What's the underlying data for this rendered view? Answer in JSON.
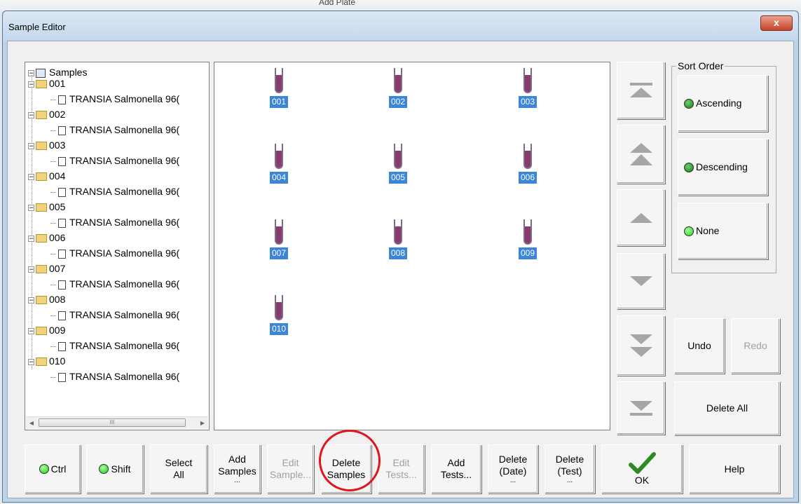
{
  "background_window": {
    "label": "Add Plate"
  },
  "window": {
    "title": "Sample Editor",
    "close_label": "x"
  },
  "tree": {
    "root": "Samples",
    "items": [
      {
        "id": "001",
        "child": "TRANSIA Salmonella 96("
      },
      {
        "id": "002",
        "child": "TRANSIA Salmonella 96("
      },
      {
        "id": "003",
        "child": "TRANSIA Salmonella 96("
      },
      {
        "id": "004",
        "child": "TRANSIA Salmonella 96("
      },
      {
        "id": "005",
        "child": "TRANSIA Salmonella 96("
      },
      {
        "id": "006",
        "child": "TRANSIA Salmonella 96("
      },
      {
        "id": "007",
        "child": "TRANSIA Salmonella 96("
      },
      {
        "id": "008",
        "child": "TRANSIA Salmonella 96("
      },
      {
        "id": "009",
        "child": "TRANSIA Salmonella 96("
      },
      {
        "id": "010",
        "child": "TRANSIA Salmonella 96("
      }
    ],
    "scroll_grip": "III"
  },
  "tubes": [
    "001",
    "002",
    "003",
    "004",
    "005",
    "006",
    "007",
    "008",
    "009",
    "010"
  ],
  "sort_order": {
    "legend": "Sort Order",
    "options": [
      {
        "label": "Ascending",
        "state": "dark"
      },
      {
        "label": "Descending",
        "state": "dark"
      },
      {
        "label": "None",
        "state": "bright"
      }
    ]
  },
  "side_buttons": {
    "undo": "Undo",
    "redo": "Redo",
    "delete_all": "Delete All"
  },
  "bottom_buttons": {
    "ctrl": "Ctrl",
    "shift": "Shift",
    "select_all": [
      "Select",
      "All"
    ],
    "add_samples": [
      "Add",
      "Samples",
      "..."
    ],
    "edit_samples": [
      "Edit",
      "Sample..."
    ],
    "delete_samples": [
      "Delete",
      "Samples"
    ],
    "edit_tests": [
      "Edit",
      "Tests..."
    ],
    "add_tests": [
      "Add",
      "Tests..."
    ],
    "delete_date": [
      "Delete",
      "(Date)",
      "..."
    ],
    "delete_test": [
      "Delete",
      "(Test)",
      "..."
    ],
    "ok": "OK",
    "help": "Help"
  },
  "colors": {
    "tube_liquid": "#8a3b6e",
    "label_bg": "#3b86d8",
    "highlight_circle": "#e0141d",
    "ok_check": "#2e8b22"
  }
}
